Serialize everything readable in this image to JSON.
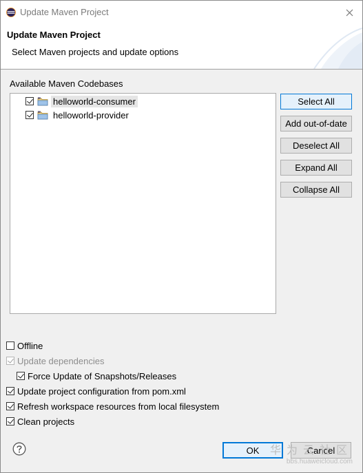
{
  "window": {
    "title": "Update Maven Project"
  },
  "header": {
    "title": "Update Maven Project",
    "description": "Select Maven projects and update options"
  },
  "codebases": {
    "label": "Available Maven Codebases",
    "items": [
      {
        "label": "helloworld-consumer",
        "checked": true,
        "selected": true,
        "icon": "maven-project-folder-icon"
      },
      {
        "label": "helloworld-provider",
        "checked": true,
        "selected": false,
        "icon": "maven-project-folder-icon"
      }
    ]
  },
  "side_buttons": {
    "select_all": "Select All",
    "add_out_of_date": "Add out-of-date",
    "deselect_all": "Deselect All",
    "expand_all": "Expand All",
    "collapse_all": "Collapse All"
  },
  "options": {
    "offline": {
      "label": "Offline",
      "checked": false
    },
    "update_dependencies": {
      "label": "Update dependencies",
      "checked": true,
      "enabled": false
    },
    "force_update": {
      "label": "Force Update of Snapshots/Releases",
      "checked": true
    },
    "update_config": {
      "label": "Update project configuration from pom.xml",
      "checked": true
    },
    "refresh_workspace": {
      "label": "Refresh workspace resources from local filesystem",
      "checked": true
    },
    "clean_projects": {
      "label": "Clean projects",
      "checked": true
    }
  },
  "footer": {
    "ok_label": "OK",
    "cancel_label": "Cancel",
    "help_icon": "help-icon"
  },
  "watermark": {
    "text": "华为云社区",
    "url": "bbs.huaweicloud.com"
  },
  "colors": {
    "accent": "#0078d7",
    "button_bg": "#e1e1e1",
    "dialog_bg": "#f0f0f0",
    "selection_bg": "#e5e5e5"
  }
}
